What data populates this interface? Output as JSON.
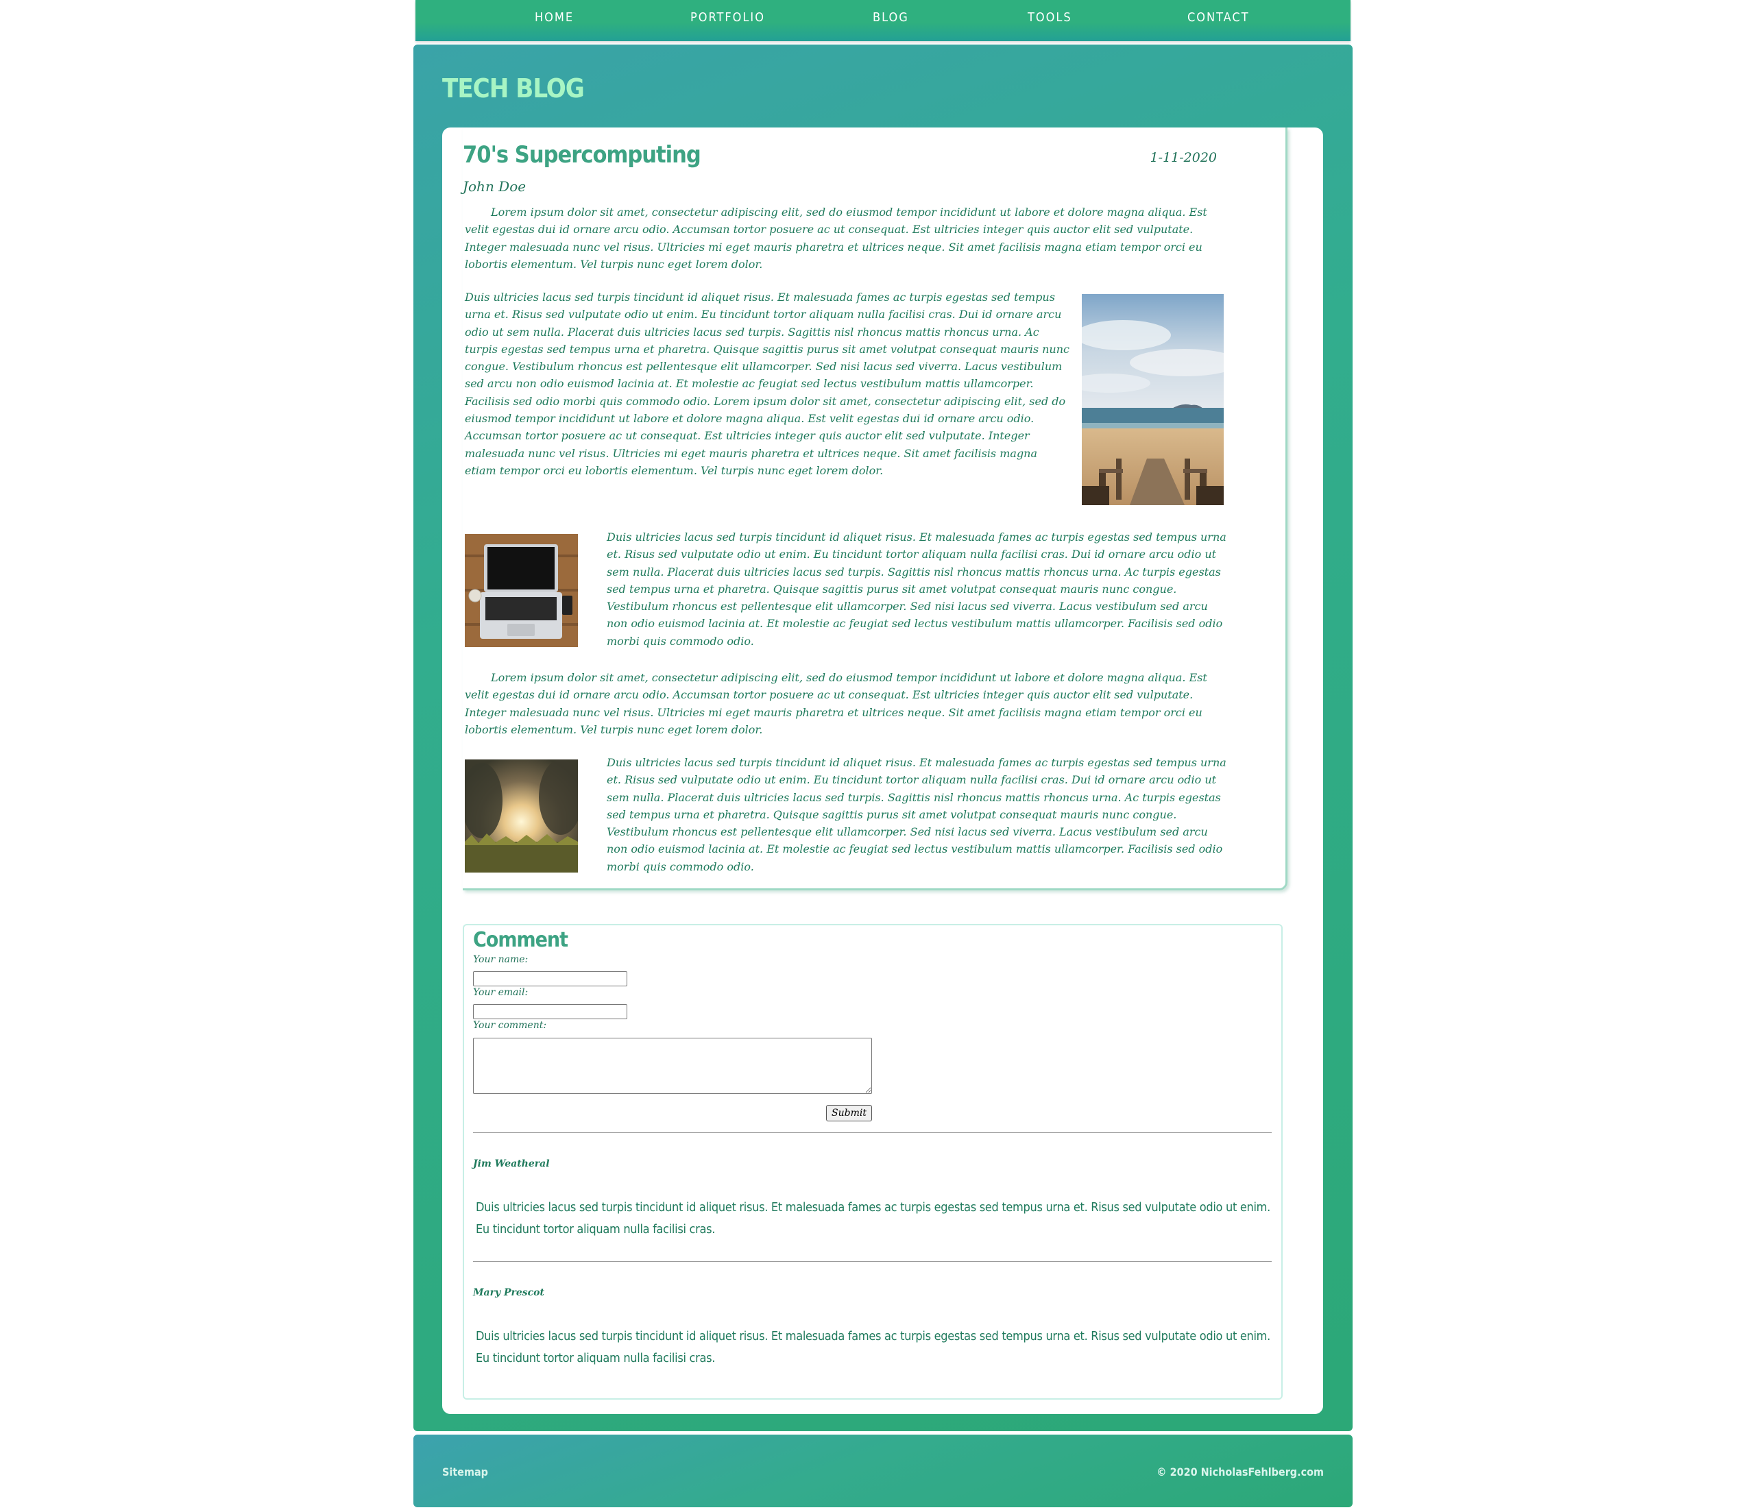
{
  "nav": {
    "items": [
      {
        "label": "HOME"
      },
      {
        "label": "PORTFOLIO"
      },
      {
        "label": "BLOG"
      },
      {
        "label": "TOOLS"
      },
      {
        "label": "CONTACT"
      }
    ]
  },
  "header": {
    "site_title": "TECH BLOG"
  },
  "post": {
    "title": "70's Supercomputing",
    "date": "1-11-2020",
    "author": "John Doe",
    "paragraphs": [
      "Lorem ipsum dolor sit amet, consectetur adipiscing elit, sed do eiusmod tempor incididunt ut labore et dolore magna aliqua. Est velit egestas dui id ornare arcu odio. Accumsan tortor posuere ac ut consequat. Est ultricies integer quis auctor elit sed vulputate. Integer malesuada nunc vel risus. Ultricies mi eget mauris pharetra et ultrices neque. Sit amet facilisis magna etiam tempor orci eu lobortis elementum. Vel turpis nunc eget lorem dolor.",
      "Duis ultricies lacus sed turpis tincidunt id aliquet risus. Et malesuada fames ac turpis egestas sed tempus urna et. Risus sed vulputate odio ut enim. Eu tincidunt tortor aliquam nulla facilisi cras. Dui id ornare arcu odio ut sem nulla. Placerat duis ultricies lacus sed turpis. Sagittis nisl rhoncus mattis rhoncus urna. Ac turpis egestas sed tempus urna et pharetra. Quisque sagittis purus sit amet volutpat consequat mauris nunc congue. Vestibulum rhoncus est pellentesque elit ullamcorper. Sed nisi lacus sed viverra. Lacus vestibulum sed arcu non odio euismod lacinia at. Et molestie ac feugiat sed lectus vestibulum mattis ullamcorper. Facilisis sed odio morbi quis commodo odio. Lorem ipsum dolor sit amet, consectetur adipiscing elit, sed do eiusmod tempor incididunt ut labore et dolore magna aliqua. Est velit egestas dui id ornare arcu odio. Accumsan tortor posuere ac ut consequat. Est ultricies integer quis auctor elit sed vulputate. Integer malesuada nunc vel risus. Ultricies mi eget mauris pharetra et ultrices neque. Sit amet facilisis magna etiam tempor orci eu lobortis elementum. Vel turpis nunc eget lorem dolor.",
      "Duis ultricies lacus sed turpis tincidunt id aliquet risus. Et malesuada fames ac turpis egestas sed tempus urna et. Risus sed vulputate odio ut enim. Eu tincidunt tortor aliquam nulla facilisi cras. Dui id ornare arcu odio ut sem nulla. Placerat duis ultricies lacus sed turpis. Sagittis nisl rhoncus mattis rhoncus urna. Ac turpis egestas sed tempus urna et pharetra. Quisque sagittis purus sit amet volutpat consequat mauris nunc congue. Vestibulum rhoncus est pellentesque elit ullamcorper. Sed nisi lacus sed viverra. Lacus vestibulum sed arcu non odio euismod lacinia at. Et molestie ac feugiat sed lectus vestibulum mattis ullamcorper. Facilisis sed odio morbi quis commodo odio.",
      "Lorem ipsum dolor sit amet, consectetur adipiscing elit, sed do eiusmod tempor incididunt ut labore et dolore magna aliqua. Est velit egestas dui id ornare arcu odio. Accumsan tortor posuere ac ut consequat. Est ultricies integer quis auctor elit sed vulputate. Integer malesuada nunc vel risus. Ultricies mi eget mauris pharetra et ultrices neque. Sit amet facilisis magna etiam tempor orci eu lobortis elementum. Vel turpis nunc eget lorem dolor.",
      "Duis ultricies lacus sed turpis tincidunt id aliquet risus. Et malesuada fames ac turpis egestas sed tempus urna et. Risus sed vulputate odio ut enim. Eu tincidunt tortor aliquam nulla facilisi cras. Dui id ornare arcu odio ut sem nulla. Placerat duis ultricies lacus sed turpis. Sagittis nisl rhoncus mattis rhoncus urna. Ac turpis egestas sed tempus urna et pharetra. Quisque sagittis purus sit amet volutpat consequat mauris nunc congue. Vestibulum rhoncus est pellentesque elit ullamcorper. Sed nisi lacus sed viverra. Lacus vestibulum sed arcu non odio euismod lacinia at. Et molestie ac feugiat sed lectus vestibulum mattis ullamcorper. Facilisis sed odio morbi quis commodo odio."
    ],
    "images": [
      {
        "subject": "beach-boardwalk-photo"
      },
      {
        "subject": "laptop-on-desk-photo"
      },
      {
        "subject": "sunset-field-photo"
      }
    ]
  },
  "comment_form": {
    "heading": "Comment",
    "name_label": "Your name:",
    "name_value": "",
    "email_label": "Your email:",
    "email_value": "",
    "comment_label": "Your comment:",
    "comment_value": "",
    "submit_label": "Submit"
  },
  "comments": [
    {
      "author": "Jim Weatheral",
      "text": "Duis ultricies lacus sed turpis tincidunt id aliquet risus. Et malesuada fames ac turpis egestas sed tempus urna et. Risus sed vulputate odio ut enim. Eu tincidunt tortor aliquam nulla facilisi cras."
    },
    {
      "author": "Mary Prescot",
      "text": "Duis ultricies lacus sed turpis tincidunt id aliquet risus. Et malesuada fames ac turpis egestas sed tempus urna et. Risus sed vulputate odio ut enim. Eu tincidunt tortor aliquam nulla facilisi cras."
    }
  ],
  "footer": {
    "sitemap_label": "Sitemap",
    "copyright": "© 2020 NicholasFehlberg.com"
  },
  "colors": {
    "accent_green": "#2fb07f",
    "title_mint": "#a8f5c4",
    "text_green": "#1f7a5c"
  }
}
